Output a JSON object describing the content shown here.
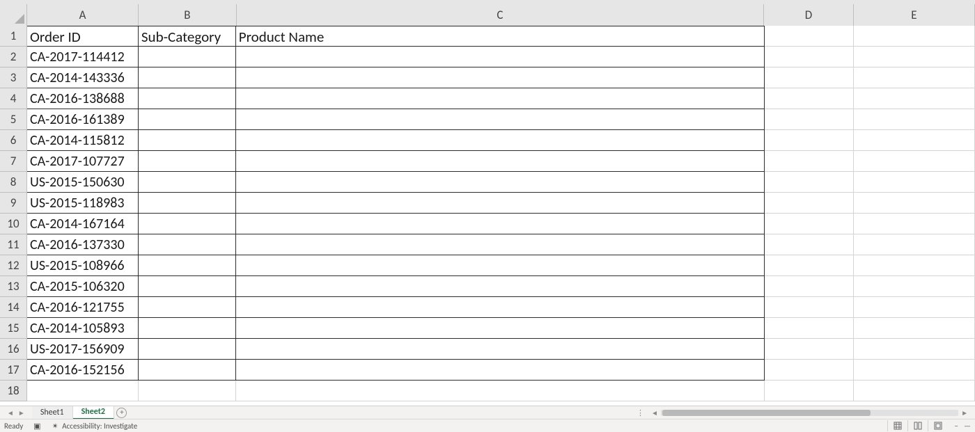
{
  "columns": [
    {
      "letter": "A",
      "width_class": "cA"
    },
    {
      "letter": "B",
      "width_class": "cB"
    },
    {
      "letter": "C",
      "width_class": "cC"
    },
    {
      "letter": "D",
      "width_class": "cD"
    },
    {
      "letter": "E",
      "width_class": "cE"
    }
  ],
  "header_row": {
    "A": "Order ID",
    "B": "Sub-Category",
    "C": "Product Name"
  },
  "data_rows": [
    {
      "n": 2,
      "A": "CA-2017-114412",
      "B": "",
      "C": ""
    },
    {
      "n": 3,
      "A": "CA-2014-143336",
      "B": "",
      "C": ""
    },
    {
      "n": 4,
      "A": "CA-2016-138688",
      "B": "",
      "C": ""
    },
    {
      "n": 5,
      "A": "CA-2016-161389",
      "B": "",
      "C": ""
    },
    {
      "n": 6,
      "A": "CA-2014-115812",
      "B": "",
      "C": ""
    },
    {
      "n": 7,
      "A": "CA-2017-107727",
      "B": "",
      "C": ""
    },
    {
      "n": 8,
      "A": "US-2015-150630",
      "B": "",
      "C": ""
    },
    {
      "n": 9,
      "A": "US-2015-118983",
      "B": "",
      "C": ""
    },
    {
      "n": 10,
      "A": "CA-2014-167164",
      "B": "",
      "C": ""
    },
    {
      "n": 11,
      "A": "CA-2016-137330",
      "B": "",
      "C": ""
    },
    {
      "n": 12,
      "A": "US-2015-108966",
      "B": "",
      "C": ""
    },
    {
      "n": 13,
      "A": "CA-2015-106320",
      "B": "",
      "C": ""
    },
    {
      "n": 14,
      "A": "CA-2016-121755",
      "B": "",
      "C": ""
    },
    {
      "n": 15,
      "A": "CA-2014-105893",
      "B": "",
      "C": ""
    },
    {
      "n": 16,
      "A": "US-2017-156909",
      "B": "",
      "C": ""
    },
    {
      "n": 17,
      "A": "CA-2016-152156",
      "B": "",
      "C": ""
    }
  ],
  "trailing_empty_row": 18,
  "tabs": {
    "items": [
      {
        "label": "Sheet1",
        "active": false
      },
      {
        "label": "Sheet2",
        "active": true
      }
    ]
  },
  "status": {
    "ready": "Ready",
    "accessibility": "Accessibility: Investigate"
  }
}
